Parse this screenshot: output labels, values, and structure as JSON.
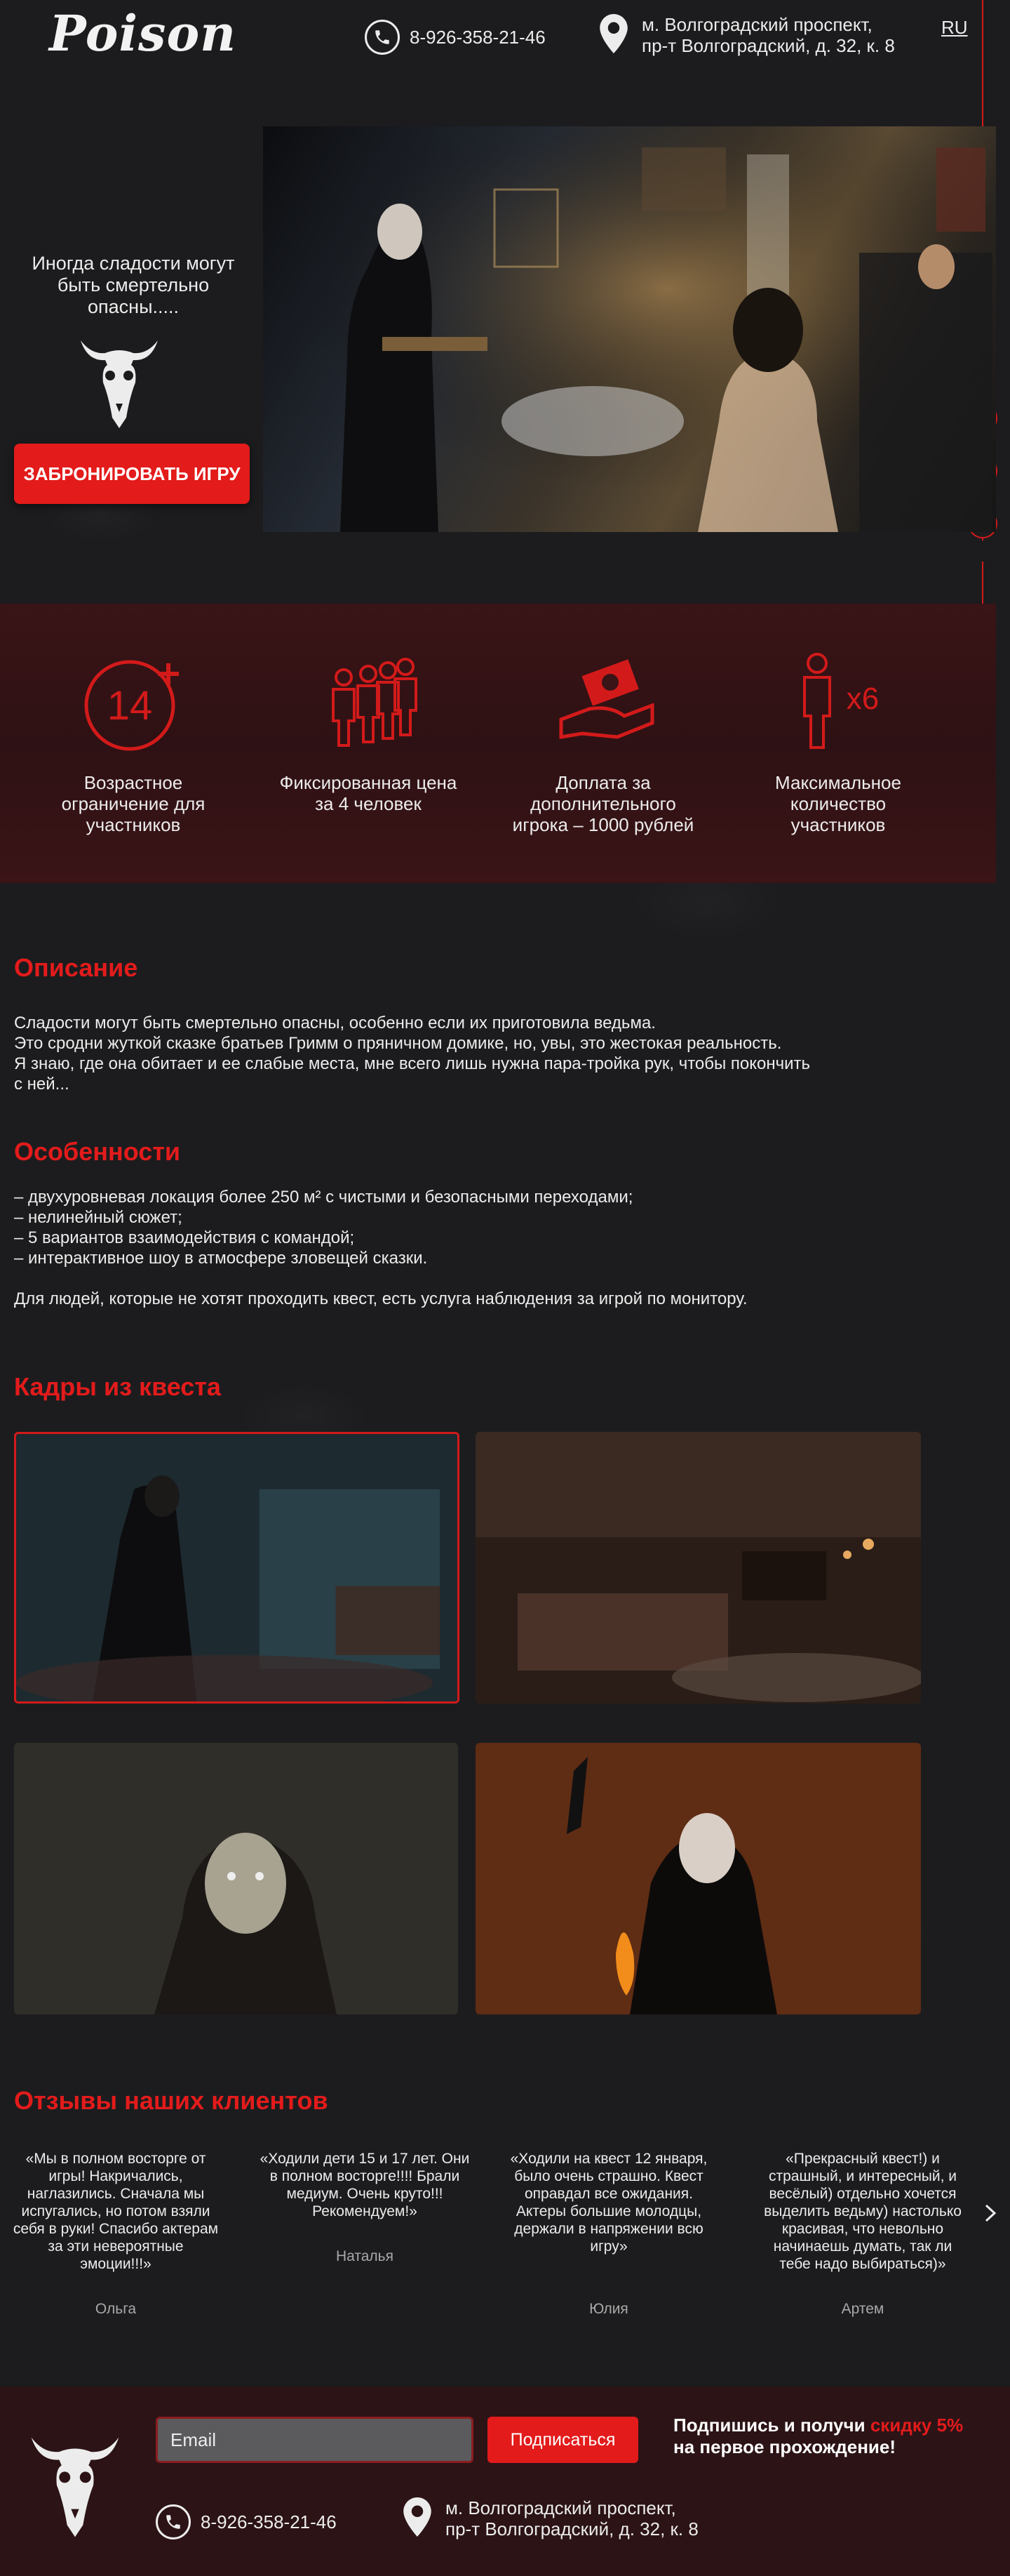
{
  "colors": {
    "accent": "#e31b1b",
    "background": "#1c1c1e",
    "band": "#3a1416"
  },
  "header": {
    "logo": "Poison",
    "phone": "8-926-358-21-46",
    "address_line1": "м. Волгоградский проспект,",
    "address_line2": "пр-т Волгоградский, д. 32, к. 8",
    "lang": "RU"
  },
  "social": [
    {
      "icon": "vk-icon"
    },
    {
      "icon": "youtube-icon"
    },
    {
      "icon": "instagram-icon"
    }
  ],
  "hero": {
    "tagline": "Иногда сладости могут быть смертельно опасны.....",
    "cta": "ЗАБРОНИРОВАТЬ ИГРУ"
  },
  "features": [
    {
      "icon": "age-14-plus-icon",
      "badge": "14",
      "label": "Возрастное ограничение для участников"
    },
    {
      "icon": "group-people-icon",
      "label": "Фиксированная цена за 4 человек"
    },
    {
      "icon": "hand-money-icon",
      "label": "Доплата за дополнительного игрока – 1000 рублей"
    },
    {
      "icon": "person-x6-icon",
      "badge": "x6",
      "label": "Максимальное количество участников"
    }
  ],
  "description": {
    "title": "Описание",
    "lines": [
      "Сладости могут быть смертельно опасны, особенно если их приготовила ведьма.",
      "Это сродни жуткой сказке братьев Гримм о пряничном домике, но, увы, это жестокая реальность.",
      "Я знаю, где она обитает и ее слабые места, мне всего лишь нужна пара-тройка рук, чтобы покончить",
      "с ней..."
    ]
  },
  "features_text": {
    "title": "Особенности",
    "items": [
      "– двухуровневая локация более 250 м² с чистыми и безопасными переходами;",
      "– нелинейный сюжет;",
      "– 5 вариантов взаимодействия с командой;",
      "– интерактивное шоу в атмосфере зловещей сказки."
    ],
    "note": "Для людей, которые не хотят проходить квест, есть услуга наблюдения за игрой по монитору."
  },
  "gallery": {
    "title": "Кадры из квеста"
  },
  "reviews": {
    "title": "Отзывы наших клиентов",
    "items": [
      {
        "text": "«Мы в полном восторге от игры! Накричались, наглазились. Сначала мы испугались, но потом взяли себя в руки! Спасибо актерам за эти невероятные эмоции!!!»",
        "author": "Ольга"
      },
      {
        "text": "«Ходили дети 15 и 17 лет. Они в полном восторге!!!! Брали медиум. Очень круто!!! Рекомендуем!»",
        "author": "Наталья"
      },
      {
        "text": "«Ходили на квест 12 января, было очень страшно. Квест оправдал все ожидания. Актеры большие молодцы, держали в напряжении всю игру»",
        "author": "Юлия"
      },
      {
        "text": "«Прекрасный квест!) и страшный, и интересный, и весёлый) отдельно хочется выделить ведьму) настолько красивая, что невольно начинаешь думать, так ли тебе надо выбираться)»",
        "author": "Артем"
      }
    ]
  },
  "footer": {
    "email_placeholder": "Email",
    "subscribe": "Подписаться",
    "promo_prefix": "Подпишись и получи ",
    "promo_accent": "скидку 5%",
    "promo_suffix": "на первое прохождение!",
    "phone": "8-926-358-21-46",
    "address_line1": "м. Волгоградский проспект,",
    "address_line2": "пр-т Волгоградский, д. 32, к. 8"
  }
}
